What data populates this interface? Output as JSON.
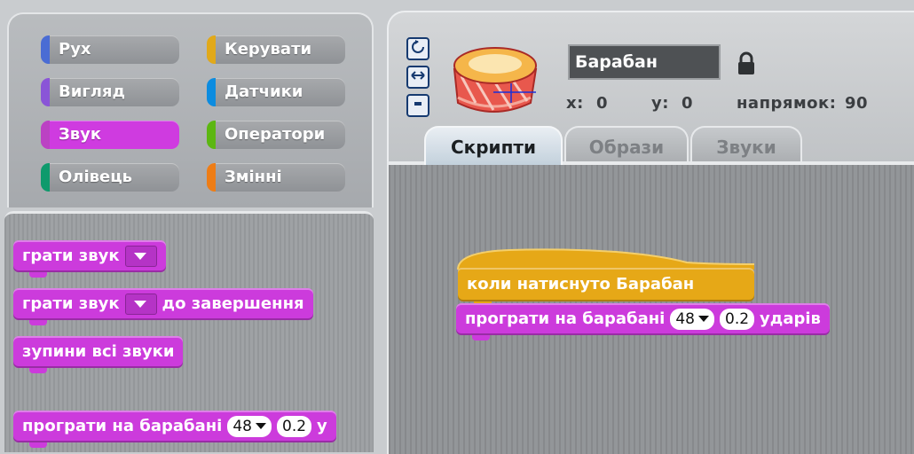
{
  "categories": [
    {
      "label": "Рух",
      "color": "#4a6cd4"
    },
    {
      "label": "Керувати",
      "color": "#e1a91a"
    },
    {
      "label": "Вигляд",
      "color": "#8a55d7"
    },
    {
      "label": "Датчики",
      "color": "#0c8ce0"
    },
    {
      "label": "Звук",
      "color": "#bb42c3",
      "active": true
    },
    {
      "label": "Оператори",
      "color": "#5cb712"
    },
    {
      "label": "Олівець",
      "color": "#0e9a6c"
    },
    {
      "label": "Змінні",
      "color": "#ee7d16"
    }
  ],
  "palette_blocks": {
    "play_sound": "грати звук",
    "play_sound_until_done": "грати звук",
    "until_done_suffix": "до завершення",
    "stop_all_sounds": "зупини всі звуки",
    "play_drum": "програти на барабані",
    "drum_value": "48",
    "beats_value": "0.2",
    "beats_suffix": "у"
  },
  "sprite": {
    "name": "Барабан",
    "x_label": "x:",
    "x_value": "0",
    "y_label": "y:",
    "y_value": "0",
    "direction_label": "напрямок:",
    "direction_value": "90",
    "rotation_controls": [
      "rotate-icon",
      "flip-icon",
      "no-rotate-icon"
    ]
  },
  "tabs": [
    {
      "label": "Скрипти",
      "active": true
    },
    {
      "label": "Образи",
      "active": false
    },
    {
      "label": "Звуки",
      "active": false
    }
  ],
  "script": {
    "hat": "коли натиснуто Барабан",
    "drum_block": "програти на барабані",
    "drum_value": "48",
    "beats_value": "0.2",
    "beats_suffix": "ударів"
  },
  "colors": {
    "sound_block": "#cc3bdc",
    "control_block": "#e6a817"
  }
}
